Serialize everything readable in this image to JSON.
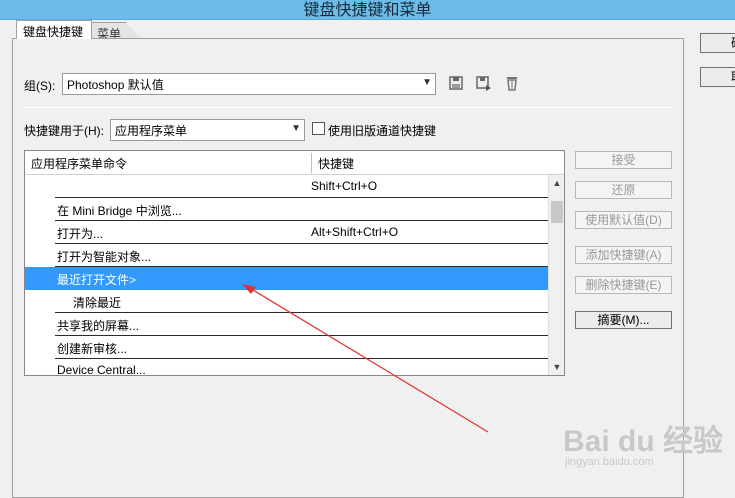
{
  "window": {
    "title": "键盘快捷键和菜单"
  },
  "tabs": [
    {
      "label": "键盘快捷键",
      "active": true
    },
    {
      "label": "菜单",
      "active": false
    }
  ],
  "group": {
    "label": "组(S):",
    "value": "Photoshop 默认值"
  },
  "toolbar_icons": [
    "save-icon",
    "save-as-icon",
    "delete-icon"
  ],
  "shortcuts_for": {
    "label": "快捷键用于(H):",
    "value": "应用程序菜单",
    "legacy_checkbox_label": "使用旧版通道快捷键",
    "legacy_checked": false
  },
  "table": {
    "columns": [
      "应用程序菜单命令",
      "快捷键"
    ],
    "rows": [
      {
        "name": "",
        "shortcut": "Shift+Ctrl+O",
        "indent": 0,
        "selected": false
      },
      {
        "name": "在 Mini Bridge 中浏览...",
        "shortcut": "",
        "indent": 1,
        "selected": false
      },
      {
        "name": "打开为...",
        "shortcut": "Alt+Shift+Ctrl+O",
        "indent": 1,
        "selected": false
      },
      {
        "name": "打开为智能对象...",
        "shortcut": "",
        "indent": 1,
        "selected": false
      },
      {
        "name": "最近打开文件>",
        "shortcut": "",
        "indent": 1,
        "selected": true
      },
      {
        "name": "清除最近",
        "shortcut": "",
        "indent": 2,
        "selected": false
      },
      {
        "name": "共享我的屏幕...",
        "shortcut": "",
        "indent": 1,
        "selected": false
      },
      {
        "name": "创建新审核...",
        "shortcut": "",
        "indent": 1,
        "selected": false
      },
      {
        "name": "Device Central...",
        "shortcut": "",
        "indent": 1,
        "selected": false
      }
    ]
  },
  "buttons": {
    "accept": "接受",
    "undo": "还原",
    "use_default": "使用默认值(D)",
    "add_shortcut": "添加快捷键(A)",
    "delete_shortcut": "删除快捷键(E)",
    "summarize": "摘要(M)..."
  },
  "side_buttons": {
    "ok": "确",
    "cancel": "取"
  },
  "watermark": {
    "main": "Bai du 经验",
    "sub": "jingyan.baidu.com"
  },
  "colors": {
    "selection": "#3399ff",
    "titlebar": "#6dbbe8",
    "annotation": "#e03030"
  }
}
